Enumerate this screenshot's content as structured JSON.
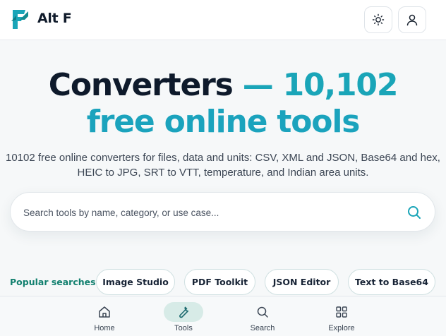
{
  "header": {
    "brand": "Alt F",
    "logo_icon": "alt-f-logo",
    "theme_icon": "sun-icon",
    "user_icon": "user-icon"
  },
  "hero": {
    "title_part1": "Converters",
    "title_part2": "— 10,102",
    "title_line2": "free online tools",
    "subtitle": "10102 free online converters for files, data and units: CSV, XML and JSON, Base64 and hex, HEIC to JPG, SRT to VTT, temperature, and Indian area units."
  },
  "search": {
    "placeholder": "Search tools by name, category, or use case...",
    "value": "",
    "icon": "search-icon"
  },
  "popular": {
    "label": "Popular searches:",
    "chips": [
      "Image Studio",
      "PDF Toolkit",
      "JSON Editor",
      "Text to Base64"
    ]
  },
  "nav": {
    "items": [
      {
        "label": "Home",
        "icon": "home-icon"
      },
      {
        "label": "Tools",
        "icon": "wrench-icon",
        "active": true
      },
      {
        "label": "Search",
        "icon": "search-icon"
      },
      {
        "label": "Explore",
        "icon": "grid-icon"
      }
    ]
  },
  "colors": {
    "accent_teal": "#1aa5b8",
    "dark_text": "#0e1a2b",
    "popular_label": "#12806f",
    "active_nav_bg": "#d7ebe7"
  }
}
